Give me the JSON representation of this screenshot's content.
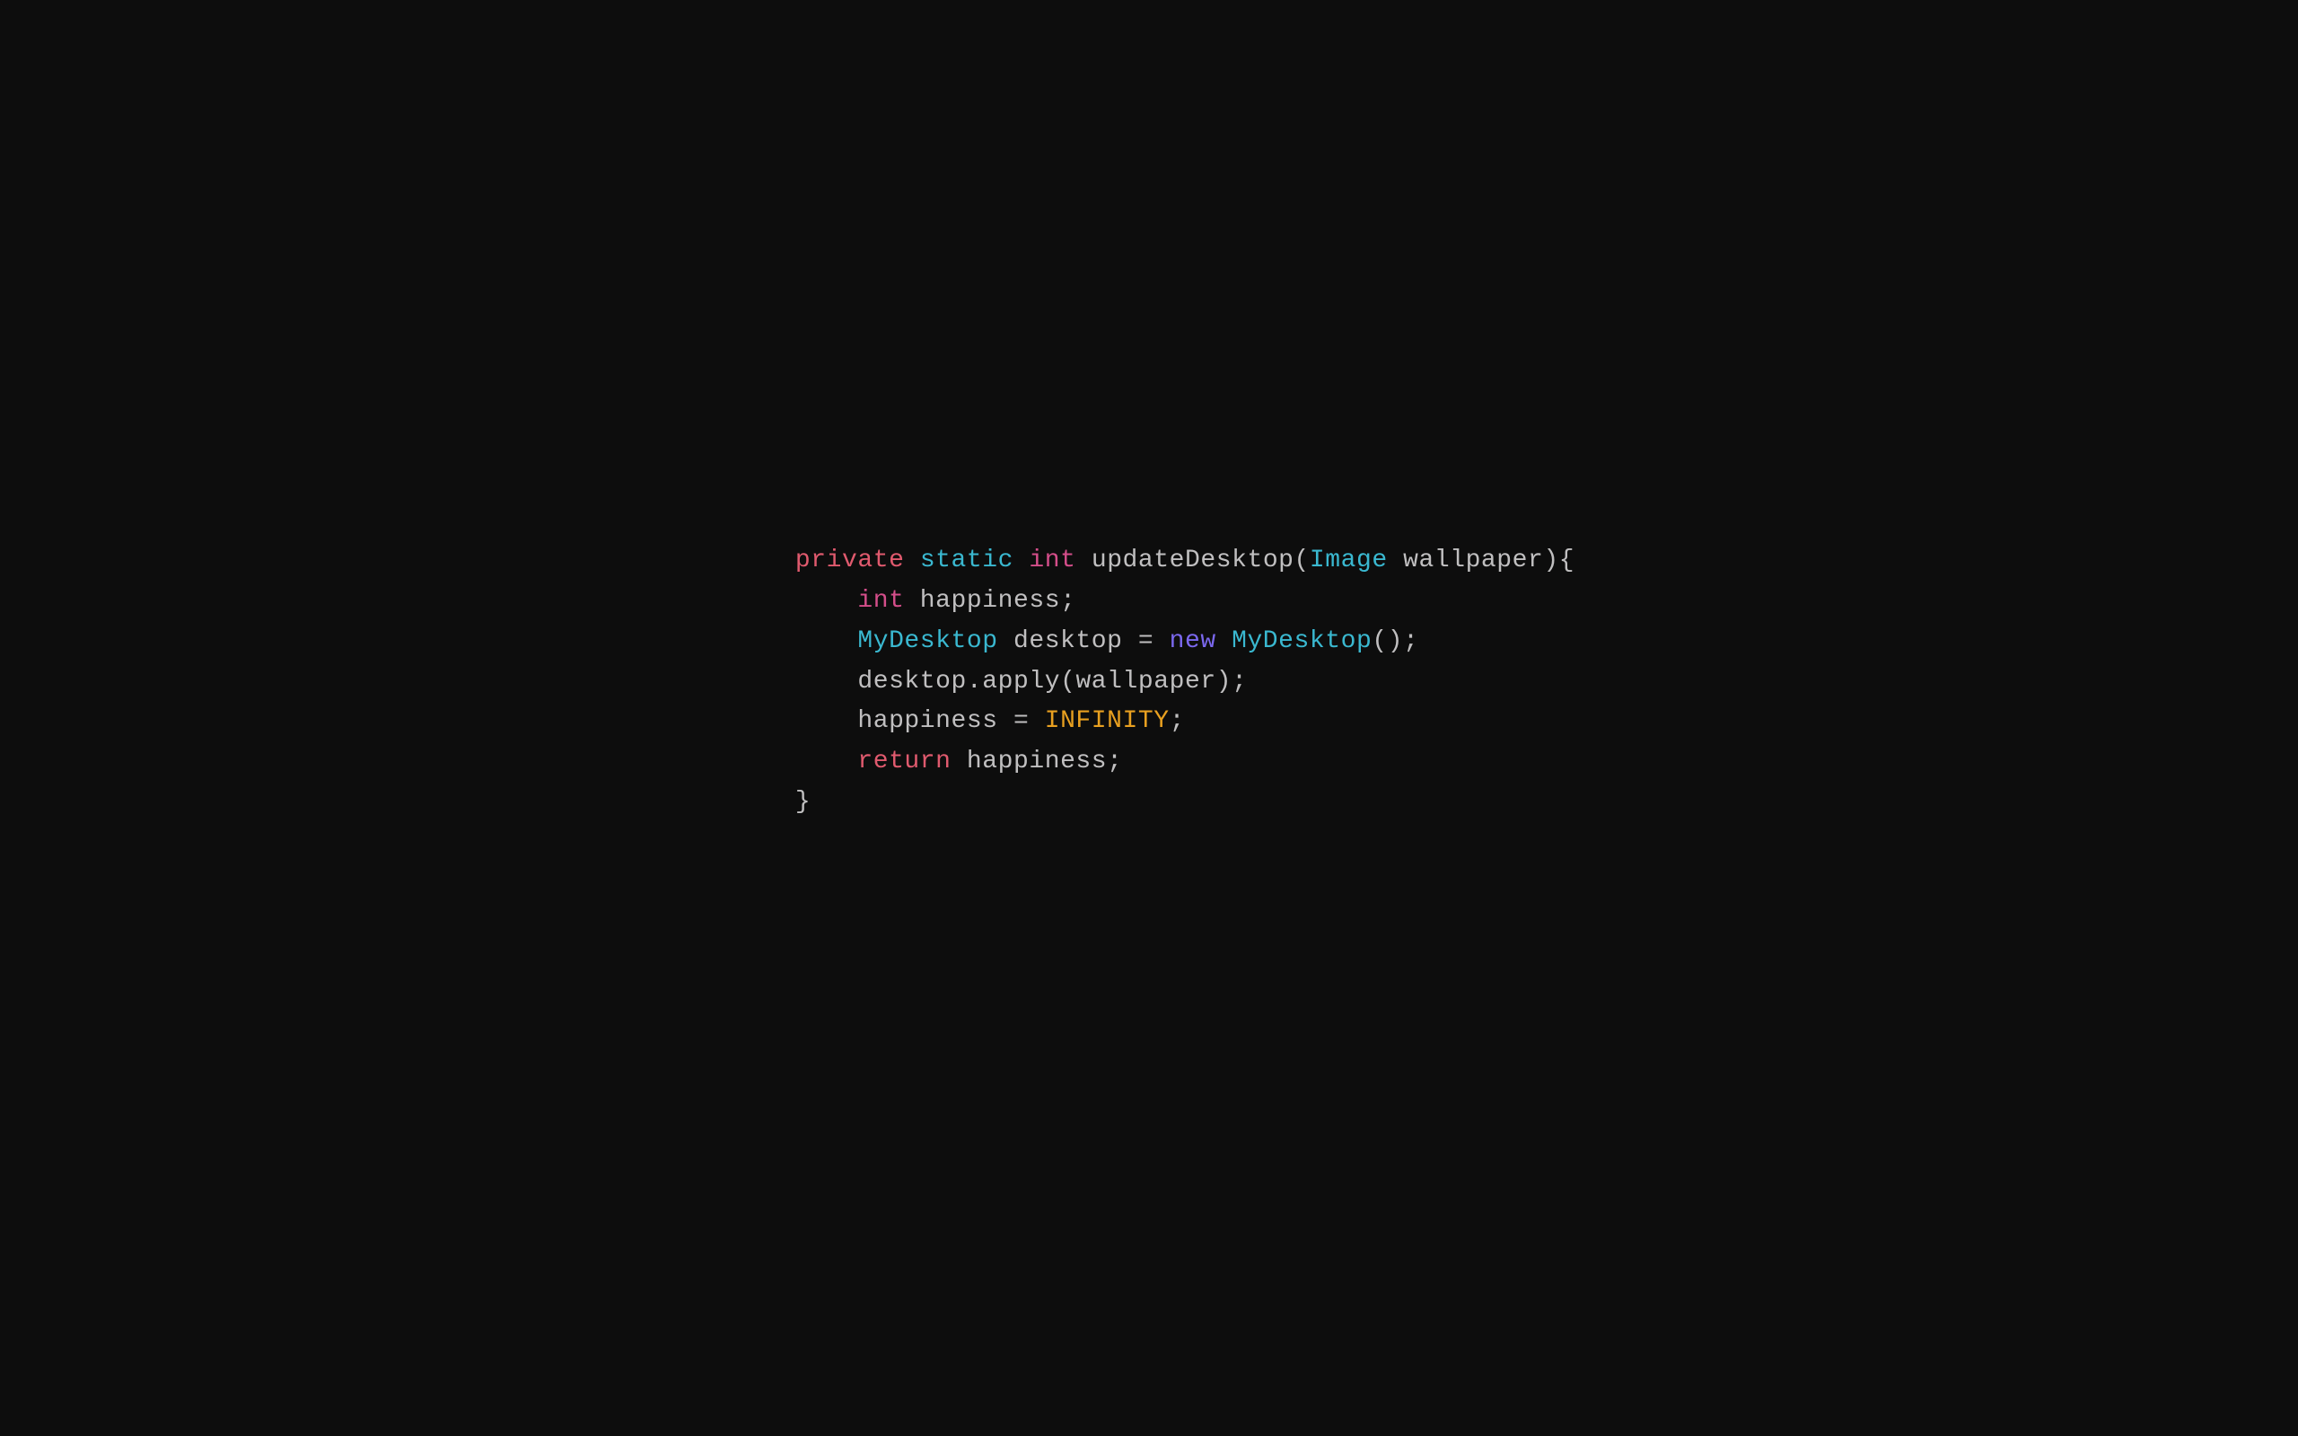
{
  "background": "#0d0d0d",
  "code": {
    "line1": {
      "private": "private",
      "static": "static",
      "int": "int",
      "rest": " updateDesktop(",
      "image": "Image",
      "rest2": " wallpaper){"
    },
    "line2": {
      "int": "int",
      "rest": " happiness;"
    },
    "line3": {
      "mydesktop1": "MyDesktop",
      "rest1": " desktop = ",
      "new": "new",
      "rest2": " ",
      "mydesktop2": "MyDesktop",
      "rest3": "();"
    },
    "line4": {
      "rest": "desktop",
      "dot": ".",
      "rest2": "apply(wallpaper);"
    },
    "line5": {
      "rest1": "happiness = ",
      "infinity": "INFINITY",
      "rest2": ";"
    },
    "line6": {
      "return": "return",
      "rest": " happiness;"
    },
    "line7": {
      "brace": "}"
    }
  }
}
